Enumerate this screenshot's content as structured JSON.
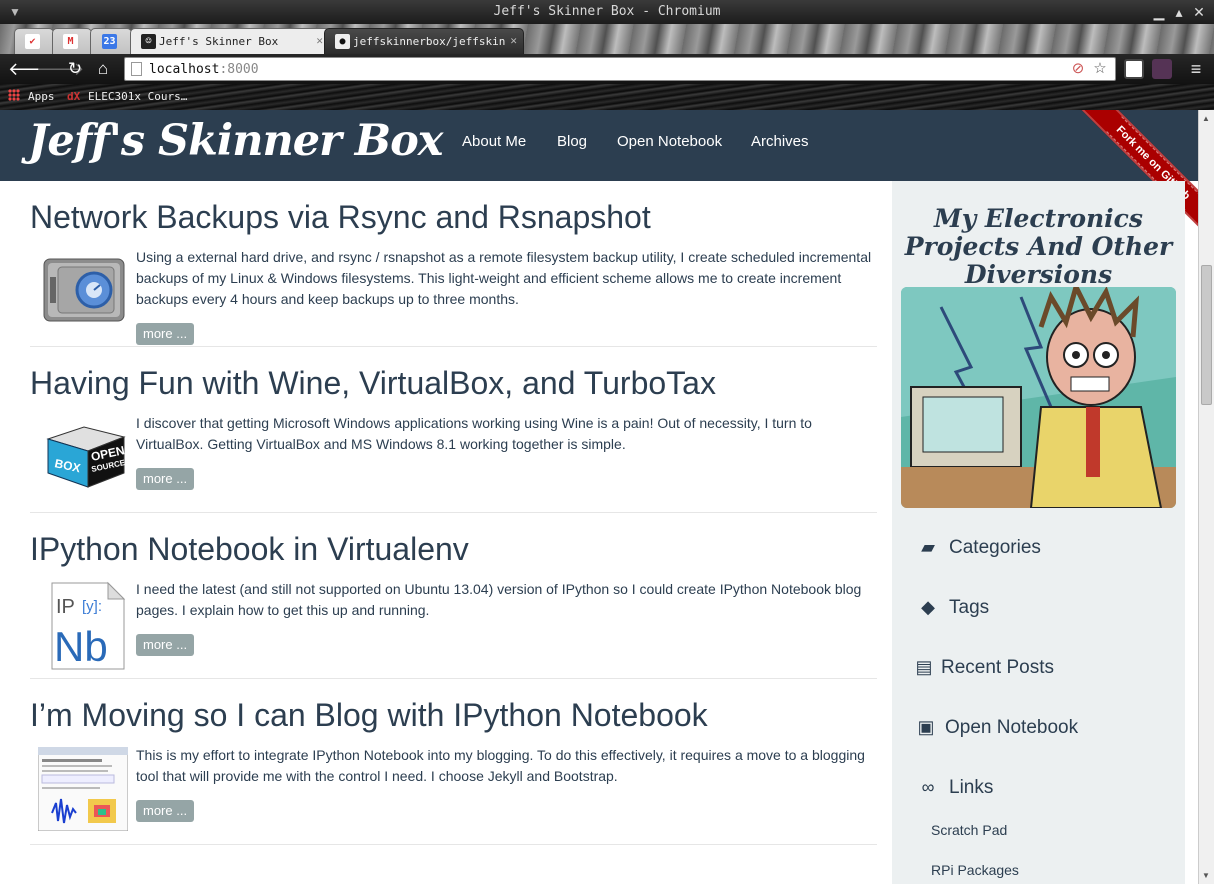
{
  "window": {
    "title": "Jeff's Skinner Box - Chromium"
  },
  "tabs": [
    {
      "label": "",
      "icon": "gmail-red-icon"
    },
    {
      "label": "",
      "icon": "gmail-icon"
    },
    {
      "label": "",
      "icon": "calendar-icon",
      "badge": "23"
    },
    {
      "label": "Jeff's Skinner Box",
      "icon": "site-favicon",
      "active": true
    },
    {
      "label": "jeffskinnerbox/jeffskin",
      "icon": "github-icon"
    }
  ],
  "toolbar": {
    "url_host": "localhost",
    "url_port": ":8000"
  },
  "bookmarks": [
    {
      "label": "Apps",
      "icon": "apps-grid-icon"
    },
    {
      "label": "ELEC301x Cours…",
      "icon": "edx-icon"
    }
  ],
  "site": {
    "brand": "Jeff's Skinner Box",
    "nav": [
      "About Me",
      "Blog",
      "Open Notebook",
      "Archives"
    ],
    "ribbon": "Fork me on GitHub"
  },
  "posts": [
    {
      "title": "Network Backups via Rsync and Rsnapshot",
      "summary": "Using a external hard drive, and rsync / rsnapshot as a remote filesystem backup utility, I create scheduled incremental backups of my Linux & Windows filesystems. This light-weight and efficient scheme allows me to create increment backups every 4 hours and keep backups up to three months.",
      "more": "more ...",
      "thumb": "safe-icon"
    },
    {
      "title": "Having Fun with Wine, VirtualBox, and TurboTax",
      "summary": "I discover that getting Microsoft Windows applications working using Wine is a pain! Out of necessity, I turn to VirtualBox. Getting VirtualBox and MS Windows 8.1 working together is simple.",
      "more": "more ...",
      "thumb": "virtualbox-cube",
      "thumb_text": [
        "OPEN",
        "SOURCE",
        "BOX"
      ]
    },
    {
      "title": "IPython Notebook in Virtualenv",
      "summary": "I need the latest (and still not supported on Ubuntu 13.04) version of IPython so I could create IPython Notebook blog pages. I explain how to get this up and running.",
      "more": "more ...",
      "thumb": "ipython-notebook-logo",
      "thumb_text": [
        "IP",
        "[y]:",
        "Nb"
      ]
    },
    {
      "title": "I’m Moving so I can Blog with IPython Notebook",
      "summary": "This is my effort to integrate IPython Notebook into my blogging. To do this effectively, it requires a move to a blogging tool that will provide me with the control I need. I choose Jekyll and Bootstrap.",
      "more": "more ...",
      "thumb": "notebook-screenshot"
    }
  ],
  "sidebar": {
    "title": "My Electronics Projects And Other Diversions",
    "items": [
      {
        "label": "Categories",
        "icon": "folder-open-icon"
      },
      {
        "label": "Tags",
        "icon": "tags-icon"
      },
      {
        "label": "Recent Posts",
        "icon": "file-text-icon"
      },
      {
        "label": "Open Notebook",
        "icon": "book-icon"
      },
      {
        "label": "Links",
        "icon": "link-icon"
      }
    ],
    "links": [
      "Scratch Pad",
      "RPi Packages"
    ]
  }
}
